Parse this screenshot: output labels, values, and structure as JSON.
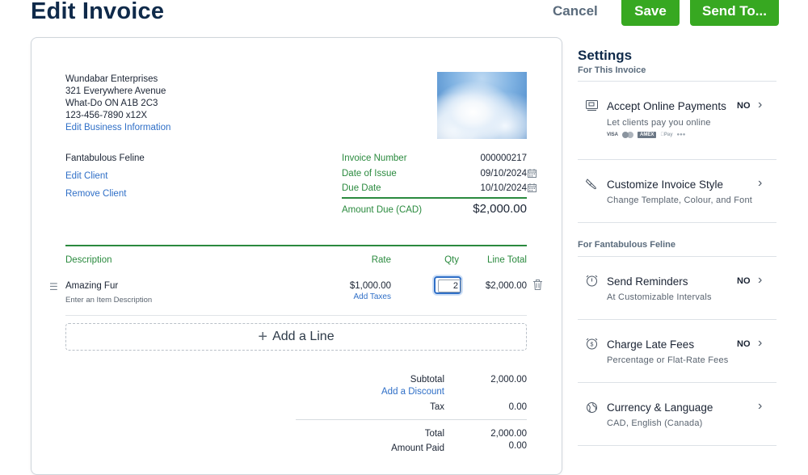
{
  "header": {
    "title": "Edit Invoice",
    "cancel_label": "Cancel",
    "save_label": "Save",
    "send_label": "Send To..."
  },
  "business": {
    "name": "Wundabar Enterprises",
    "address1": "321 Everywhere Avenue",
    "address2": "What-Do ON  A1B 2C3",
    "phone": "123-456-7890 x12X",
    "edit_link": "Edit Business Information"
  },
  "client": {
    "name": "Fantabulous Feline",
    "edit_link": "Edit Client",
    "remove_link": "Remove Client"
  },
  "meta": {
    "invoice_number_label": "Invoice Number",
    "invoice_number": "000000217",
    "date_issue_label": "Date of Issue",
    "date_issue": "09/10/2024",
    "due_date_label": "Due Date",
    "due_date": "10/10/2024",
    "amount_due_label": "Amount Due (CAD)",
    "amount_due": "$2,000.00"
  },
  "items": {
    "headers": {
      "description": "Description",
      "rate": "Rate",
      "qty": "Qty",
      "total": "Line Total"
    },
    "rows": [
      {
        "name": "Amazing Fur",
        "desc_placeholder": "Enter an Item Description",
        "rate": "$1,000.00",
        "add_taxes": "Add Taxes",
        "qty": "2",
        "total": "$2,000.00"
      }
    ],
    "add_line": "Add a Line"
  },
  "totals": {
    "subtotal_label": "Subtotal",
    "subtotal": "2,000.00",
    "discount_link": "Add a Discount",
    "tax_label": "Tax",
    "tax": "0.00",
    "total_label": "Total",
    "total": "2,000.00",
    "paid_label": "Amount Paid",
    "paid": "0.00"
  },
  "settings": {
    "title": "Settings",
    "for_invoice": "For This Invoice",
    "for_client": "For Fantabulous Feline",
    "items": [
      {
        "icon": "credit-card-icon",
        "title": "Accept Online Payments",
        "desc": "Let clients pay you online",
        "status": "NO"
      },
      {
        "icon": "paintbrush-icon",
        "title": "Customize Invoice Style",
        "desc": "Change Template, Colour, and Font",
        "status": ""
      },
      {
        "icon": "alarm-clock-icon",
        "title": "Send Reminders",
        "desc": "At Customizable Intervals",
        "status": "NO"
      },
      {
        "icon": "late-fee-clock-icon",
        "title": "Charge Late Fees",
        "desc": "Percentage or Flat-Rate Fees",
        "status": "NO"
      },
      {
        "icon": "globe-icon",
        "title": "Currency & Language",
        "desc": "CAD, English (Canada)",
        "status": ""
      }
    ],
    "payment_logos": [
      "VISA",
      "AMEX"
    ]
  },
  "colors": {
    "accent_green": "#37a821",
    "link_blue": "#2f6fc7",
    "label_green": "#2a8a3e",
    "title_navy": "#0f2a4a"
  }
}
